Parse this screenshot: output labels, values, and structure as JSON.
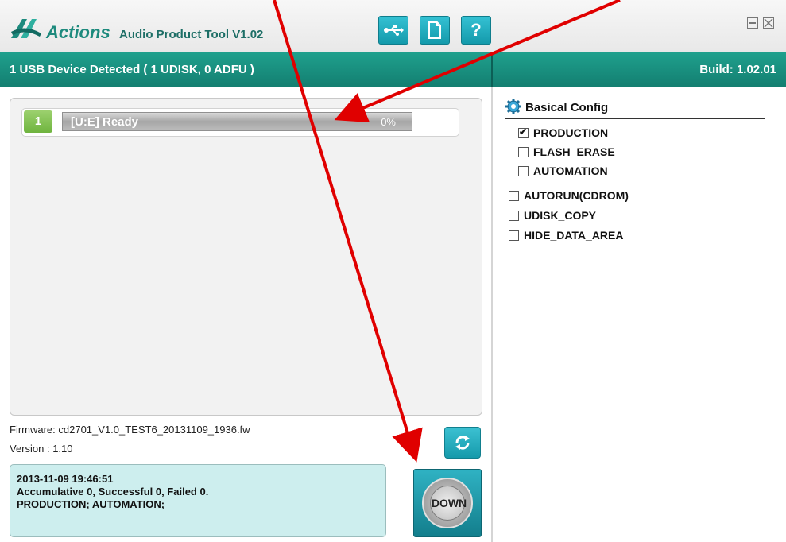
{
  "header": {
    "logo_text": "Actions",
    "title": "Audio Product Tool V1.02",
    "icons": [
      "usb-icon",
      "document-icon",
      "help-icon"
    ],
    "help_label": "?"
  },
  "status": {
    "left": "1 USB Device Detected ( 1 UDISK, 0 ADFU )",
    "right": "Build: 1.02.01"
  },
  "device": {
    "number": "1",
    "status": "[U:E] Ready",
    "progress_text": "0%",
    "progress": 0
  },
  "firmware": {
    "line": "Firmware: cd2701_V1.0_TEST6_20131109_1936.fw",
    "version": "Version : 1.10"
  },
  "log": {
    "timestamp": "2013-11-09 19:46:51",
    "summary": "Accumulative 0, Successful 0, Failed 0.",
    "modes": "PRODUCTION; AUTOMATION;"
  },
  "actions": {
    "down_label": "DOWN"
  },
  "config": {
    "title": "Basical Config",
    "items": [
      {
        "label": "PRODUCTION",
        "checked": true
      },
      {
        "label": "FLASH_ERASE",
        "checked": false
      },
      {
        "label": "AUTOMATION",
        "checked": false
      },
      {
        "label": "AUTORUN(CDROM)",
        "checked": false
      },
      {
        "label": "UDISK_COPY",
        "checked": false
      },
      {
        "label": "HIDE_DATA_AREA",
        "checked": false
      }
    ]
  },
  "colors": {
    "accent": "#1a9a88",
    "arrow": "#e00000"
  }
}
